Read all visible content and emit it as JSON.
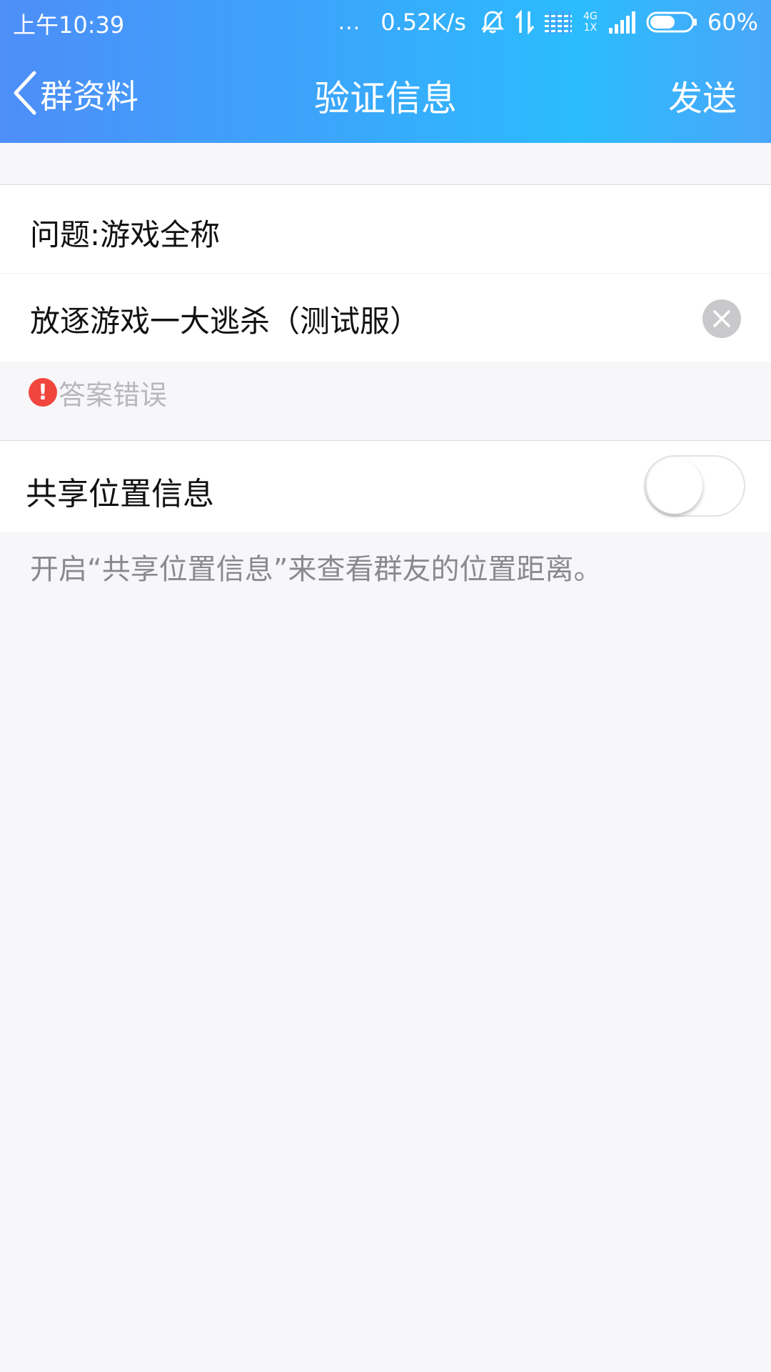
{
  "status_bar": {
    "time": "上午10:39",
    "dots": "...",
    "net_speed": "0.52K/s",
    "network_label_top": "4G",
    "network_label_bottom": "1X",
    "battery_pct": "60%",
    "battery_level": 0.6,
    "icons": [
      "mute-bell-icon",
      "data-arrows-icon",
      "signal-bars-icon",
      "signal-bars-icon",
      "battery-icon"
    ]
  },
  "nav": {
    "back_label": "群资料",
    "title": "验证信息",
    "send_label": "发送",
    "back_icon": "chevron-left-icon"
  },
  "form": {
    "question": "问题:游戏全称",
    "answer_value": "放逐游戏一大逃杀（测试服）",
    "clear_icon": "clear-icon",
    "error_icon_glyph": "!",
    "error_text": "答案错误"
  },
  "share_location": {
    "label": "共享位置信息",
    "enabled": false,
    "hint": "开启“共享位置信息”来查看群友的位置距离。"
  },
  "colors": {
    "header_gradient_start": "#4d8ef8",
    "header_gradient_end": "#2bbcfd",
    "error_red": "#f0463e",
    "background": "#f7f7f9"
  }
}
